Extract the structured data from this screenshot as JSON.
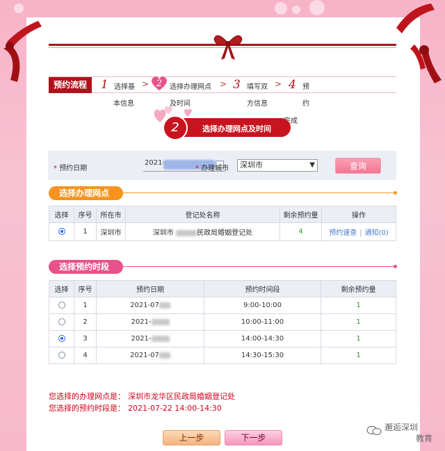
{
  "flow": {
    "label": "预约流程",
    "steps": [
      {
        "num": "1",
        "line1": "选择基",
        "line2": "本信息"
      },
      {
        "num": "2",
        "line1": "选择办理网点",
        "line2": "及时间"
      },
      {
        "num": "3",
        "line1": "填写双",
        "line2": "方信息"
      },
      {
        "num": "4",
        "line1": "预",
        "line2": "约",
        "line3": "完成"
      }
    ],
    "arrow": ">"
  },
  "banner": {
    "num": "2",
    "title": "选择办理网点及时间"
  },
  "query": {
    "date_label": "预约日期",
    "date_value": "2021-",
    "city_label": "办理城市",
    "city_value": "深圳市",
    "button": "查询",
    "required_mark": "*"
  },
  "section_office": {
    "title": "选择办理网点",
    "headers": [
      "选择",
      "序号",
      "所在市",
      "登记处名称",
      "剩余预约量",
      "操作"
    ],
    "rows": [
      {
        "selected": true,
        "index": "1",
        "city": "深圳市",
        "name_prefix": "深圳市",
        "name_suffix": "民政局婚姻登记处",
        "remaining": "4",
        "op1": "预约速查",
        "op2": "通知(0)",
        "op_sep": "|"
      }
    ]
  },
  "section_time": {
    "title": "选择预约时段",
    "headers": [
      "选择",
      "序号",
      "预约日期",
      "预约时间段",
      "剩余预约量"
    ],
    "rows": [
      {
        "selected": false,
        "index": "1",
        "date": "2021-07",
        "time": "9:00-10:00",
        "remaining": "1"
      },
      {
        "selected": false,
        "index": "2",
        "date": "2021-",
        "time": "10:00-11:00",
        "remaining": "1"
      },
      {
        "selected": true,
        "index": "3",
        "date": "2021-",
        "time": "14:00-14:30",
        "remaining": "1"
      },
      {
        "selected": false,
        "index": "4",
        "date": "2021-07",
        "time": "14:30-15:30",
        "remaining": "1"
      }
    ]
  },
  "result": {
    "office_label": "您选择的办理网点是：",
    "office_value": "深圳市龙华区民政局婚姻登记处",
    "time_label": "您选择的预约时段是：",
    "time_value": "2021-07-22 14:00-14:30"
  },
  "nav": {
    "prev": "上一步",
    "next": "下一步"
  },
  "watermark": {
    "line1": "邂逅深圳",
    "line2": "教育"
  },
  "colors": {
    "accent_red": "#b0121b",
    "orange": "#f7941d",
    "pink": "#e8528b",
    "green": "#1f9d22",
    "link": "#4a79c8"
  }
}
